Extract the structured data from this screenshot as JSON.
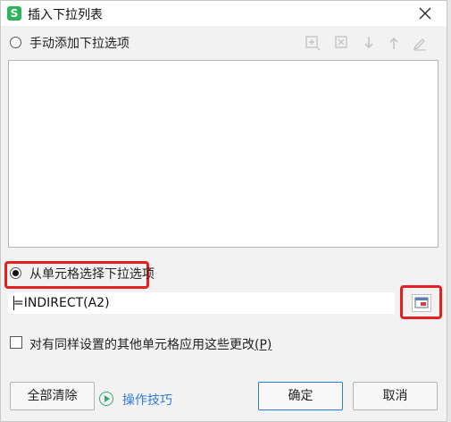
{
  "dialog": {
    "title": "插入下拉列表",
    "app_icon_glyph": "S",
    "app_icon_color": "#2fb35d"
  },
  "manual_option": {
    "label": "手动添加下拉选项",
    "selected": false
  },
  "toolbar_icons": [
    "add-item-icon",
    "delete-item-icon",
    "move-down-icon",
    "move-up-icon",
    "edit-icon"
  ],
  "list_box": {
    "items": []
  },
  "cell_option": {
    "label": "从单元格选择下拉选项",
    "selected": true
  },
  "formula": {
    "value": "=INDIRECT(A2)"
  },
  "apply_option": {
    "label": "对有同样设置的其他单元格应用这些更改",
    "shortcut": "(P)",
    "checked": false
  },
  "buttons": {
    "clear_all": "全部清除",
    "tips": "操作技巧",
    "ok": "确定",
    "cancel": "取消"
  },
  "colors": {
    "highlight": "#e62020",
    "accent": "#2f7cd6"
  }
}
